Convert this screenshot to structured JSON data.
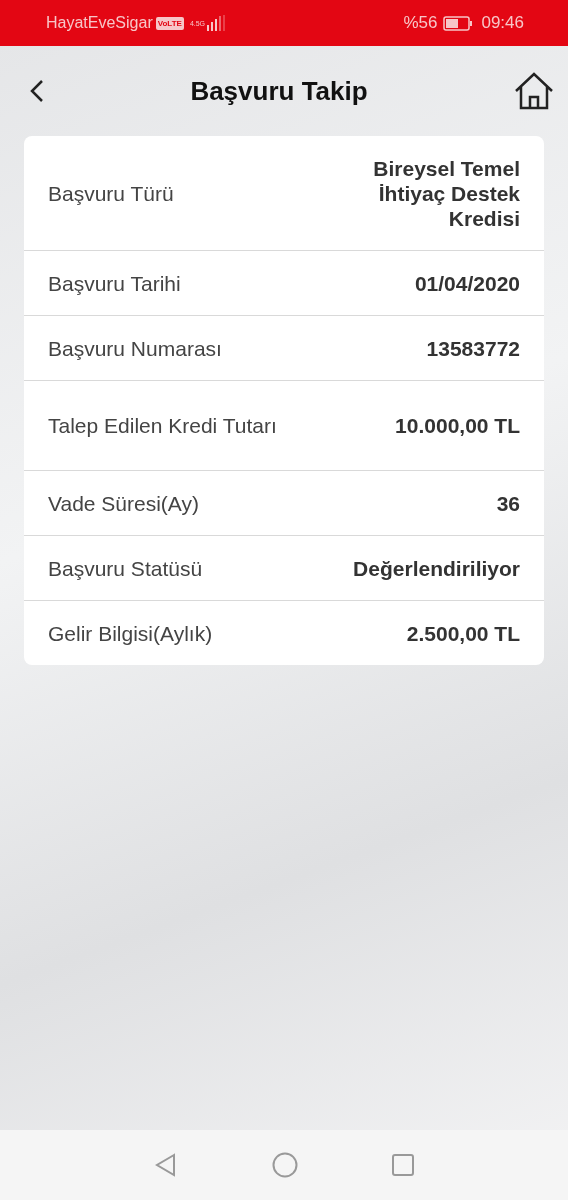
{
  "status_bar": {
    "carrier": "HayatEveSigar",
    "volte": "VoLTE",
    "network": "4.5G",
    "battery": "%56",
    "time": "09:46"
  },
  "header": {
    "title": "Başvuru Takip"
  },
  "details": [
    {
      "label": "Başvuru Türü",
      "value": "Bireysel Temel İhtiyaç Destek Kredisi"
    },
    {
      "label": "Başvuru Tarihi",
      "value": "01/04/2020"
    },
    {
      "label": "Başvuru Numarası",
      "value": "13583772"
    },
    {
      "label": "Talep Edilen Kredi Tutarı",
      "value": "10.000,00 TL"
    },
    {
      "label": "Vade Süresi(Ay)",
      "value": "36"
    },
    {
      "label": "Başvuru Statüsü",
      "value": "Değerlendiriliyor"
    },
    {
      "label": "Gelir Bilgisi(Aylık)",
      "value": "2.500,00 TL"
    }
  ]
}
